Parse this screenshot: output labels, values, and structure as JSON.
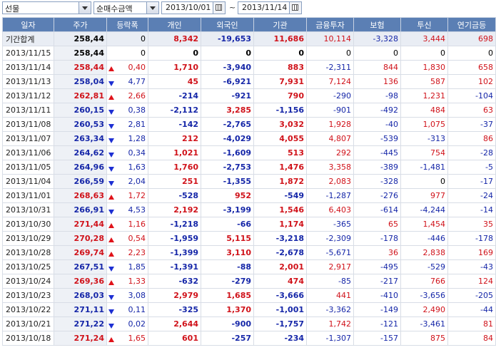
{
  "toolbar": {
    "market": "선물",
    "metric": "순매수금액",
    "date_from": "2013/10/01",
    "date_to": "2013/11/14",
    "range_sep": "~"
  },
  "columns": [
    "일자",
    "주가",
    "등락폭",
    "개인",
    "외국인",
    "기관",
    "금융투자",
    "보험",
    "투신",
    "연기금등"
  ],
  "colors": {
    "header_bg": "#5b7fb4",
    "up": "#d0121a",
    "down": "#1526a8"
  },
  "total_row": {
    "date": "기간합계",
    "price": "258,44",
    "chg": "0",
    "individual": "8,342",
    "foreign": "-19,653",
    "institution": "11,686",
    "fin_invest": "10,114",
    "insurance": "-3,328",
    "trust": "3,444",
    "pension": "698"
  },
  "rows": [
    {
      "date": "2013/11/15",
      "price": "258,44",
      "dir": "none",
      "chg": "0",
      "individual": "0",
      "foreign": "0",
      "institution": "0",
      "fin_invest": "0",
      "insurance": "0",
      "trust": "0",
      "pension": "0"
    },
    {
      "date": "2013/11/14",
      "price": "258,44",
      "dir": "up",
      "chg": "0,40",
      "individual": "1,710",
      "foreign": "-3,940",
      "institution": "883",
      "fin_invest": "-2,311",
      "insurance": "844",
      "trust": "1,830",
      "pension": "658"
    },
    {
      "date": "2013/11/13",
      "price": "258,04",
      "dir": "down",
      "chg": "4,77",
      "individual": "45",
      "foreign": "-6,921",
      "institution": "7,931",
      "fin_invest": "7,124",
      "insurance": "136",
      "trust": "587",
      "pension": "102"
    },
    {
      "date": "2013/11/12",
      "price": "262,81",
      "dir": "up",
      "chg": "2,66",
      "individual": "-214",
      "foreign": "-921",
      "institution": "790",
      "fin_invest": "-290",
      "insurance": "-98",
      "trust": "1,231",
      "pension": "-104"
    },
    {
      "date": "2013/11/11",
      "price": "260,15",
      "dir": "down",
      "chg": "0,38",
      "individual": "-2,112",
      "foreign": "3,285",
      "institution": "-1,156",
      "fin_invest": "-901",
      "insurance": "-492",
      "trust": "484",
      "pension": "63"
    },
    {
      "date": "2013/11/08",
      "price": "260,53",
      "dir": "down",
      "chg": "2,81",
      "individual": "-142",
      "foreign": "-2,765",
      "institution": "3,032",
      "fin_invest": "1,928",
      "insurance": "-40",
      "trust": "1,075",
      "pension": "-37"
    },
    {
      "date": "2013/11/07",
      "price": "263,34",
      "dir": "down",
      "chg": "1,28",
      "individual": "212",
      "foreign": "-4,029",
      "institution": "4,055",
      "fin_invest": "4,807",
      "insurance": "-539",
      "trust": "-313",
      "pension": "86"
    },
    {
      "date": "2013/11/06",
      "price": "264,62",
      "dir": "down",
      "chg": "0,34",
      "individual": "1,021",
      "foreign": "-1,609",
      "institution": "513",
      "fin_invest": "292",
      "insurance": "-445",
      "trust": "754",
      "pension": "-28"
    },
    {
      "date": "2013/11/05",
      "price": "264,96",
      "dir": "down",
      "chg": "1,63",
      "individual": "1,760",
      "foreign": "-2,753",
      "institution": "1,476",
      "fin_invest": "3,358",
      "insurance": "-389",
      "trust": "-1,481",
      "pension": "-5"
    },
    {
      "date": "2013/11/04",
      "price": "266,59",
      "dir": "down",
      "chg": "2,04",
      "individual": "251",
      "foreign": "-1,355",
      "institution": "1,872",
      "fin_invest": "2,083",
      "insurance": "-328",
      "trust": "0",
      "pension": "-17"
    },
    {
      "date": "2013/11/01",
      "price": "268,63",
      "dir": "up",
      "chg": "1,72",
      "individual": "-528",
      "foreign": "952",
      "institution": "-549",
      "fin_invest": "-1,287",
      "insurance": "-276",
      "trust": "977",
      "pension": "-24"
    },
    {
      "date": "2013/10/31",
      "price": "266,91",
      "dir": "down",
      "chg": "4,53",
      "individual": "2,192",
      "foreign": "-3,199",
      "institution": "1,546",
      "fin_invest": "6,403",
      "insurance": "-614",
      "trust": "-4,244",
      "pension": "-14"
    },
    {
      "date": "2013/10/30",
      "price": "271,44",
      "dir": "up",
      "chg": "1,16",
      "individual": "-1,218",
      "foreign": "-66",
      "institution": "1,174",
      "fin_invest": "-365",
      "insurance": "65",
      "trust": "1,454",
      "pension": "35"
    },
    {
      "date": "2013/10/29",
      "price": "270,28",
      "dir": "up",
      "chg": "0,54",
      "individual": "-1,959",
      "foreign": "5,115",
      "institution": "-3,218",
      "fin_invest": "-2,309",
      "insurance": "-178",
      "trust": "-446",
      "pension": "-178"
    },
    {
      "date": "2013/10/28",
      "price": "269,74",
      "dir": "up",
      "chg": "2,23",
      "individual": "-1,399",
      "foreign": "3,110",
      "institution": "-2,678",
      "fin_invest": "-5,671",
      "insurance": "36",
      "trust": "2,838",
      "pension": "169"
    },
    {
      "date": "2013/10/25",
      "price": "267,51",
      "dir": "down",
      "chg": "1,85",
      "individual": "-1,391",
      "foreign": "-88",
      "institution": "2,001",
      "fin_invest": "2,917",
      "insurance": "-495",
      "trust": "-529",
      "pension": "-43"
    },
    {
      "date": "2013/10/24",
      "price": "269,36",
      "dir": "up",
      "chg": "1,33",
      "individual": "-632",
      "foreign": "-279",
      "institution": "474",
      "fin_invest": "-85",
      "insurance": "-217",
      "trust": "766",
      "pension": "124"
    },
    {
      "date": "2013/10/23",
      "price": "268,03",
      "dir": "down",
      "chg": "3,08",
      "individual": "2,979",
      "foreign": "1,685",
      "institution": "-3,666",
      "fin_invest": "441",
      "insurance": "-410",
      "trust": "-3,656",
      "pension": "-205"
    },
    {
      "date": "2013/10/22",
      "price": "271,11",
      "dir": "down",
      "chg": "0,11",
      "individual": "-325",
      "foreign": "1,370",
      "institution": "-1,001",
      "fin_invest": "-3,362",
      "insurance": "-149",
      "trust": "2,490",
      "pension": "-44"
    },
    {
      "date": "2013/10/21",
      "price": "271,22",
      "dir": "down",
      "chg": "0,02",
      "individual": "2,644",
      "foreign": "-900",
      "institution": "-1,757",
      "fin_invest": "1,742",
      "insurance": "-121",
      "trust": "-3,461",
      "pension": "81"
    },
    {
      "date": "2013/10/18",
      "price": "271,24",
      "dir": "up",
      "chg": "1,65",
      "individual": "601",
      "foreign": "-257",
      "institution": "-234",
      "fin_invest": "-1,307",
      "insurance": "-157",
      "trust": "875",
      "pension": "84"
    }
  ]
}
